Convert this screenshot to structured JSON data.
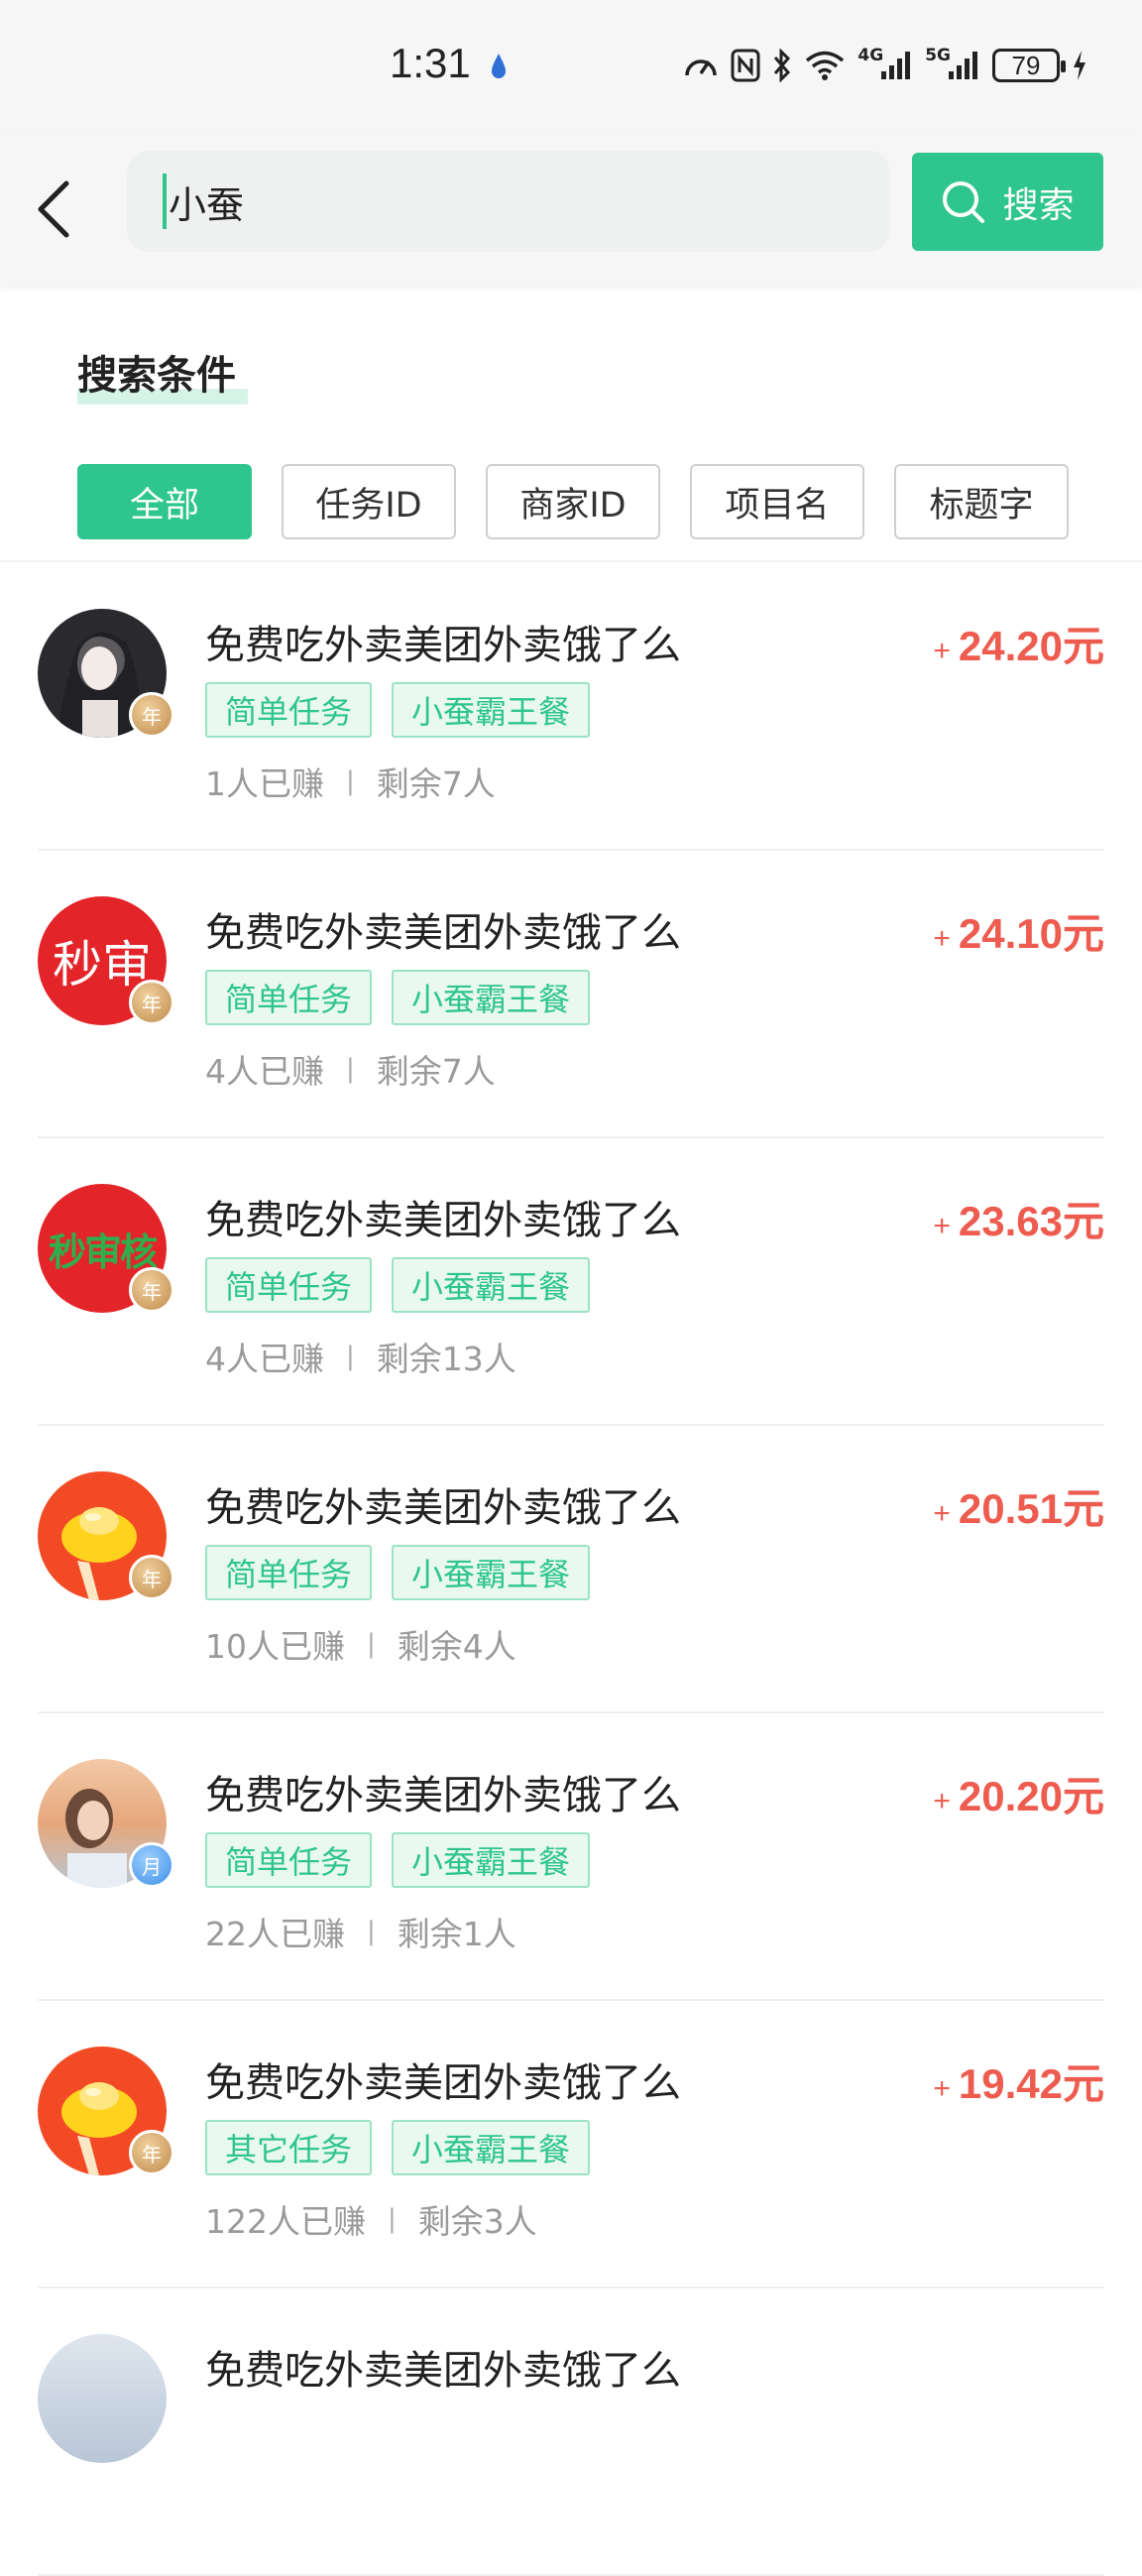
{
  "status_bar": {
    "time": "1:31",
    "signal_4g": "4G",
    "signal_5g": "5G",
    "battery": "79",
    "icons": [
      "speed-icon",
      "nfc-icon",
      "bluetooth-icon",
      "wifi-icon",
      "signal-icon",
      "signal-icon",
      "battery-icon",
      "charging-icon"
    ]
  },
  "search": {
    "value": "小蚕",
    "button_label": "搜索"
  },
  "filters": {
    "title": "搜索条件",
    "tabs": [
      "全部",
      "任务ID",
      "商家ID",
      "项目名",
      "标题字"
    ],
    "active_index": 0
  },
  "tasks": [
    {
      "title": "免费吃外卖美团外卖饿了么",
      "price": "24.20元",
      "tags": [
        "简单任务",
        "小蚕霸王餐"
      ],
      "earned": "1人已赚",
      "remaining": "剩余7人",
      "avatar_text": "",
      "level": "年"
    },
    {
      "title": "免费吃外卖美团外卖饿了么",
      "price": "24.10元",
      "tags": [
        "简单任务",
        "小蚕霸王餐"
      ],
      "earned": "4人已赚",
      "remaining": "剩余7人",
      "avatar_text": "秒审",
      "level": "年"
    },
    {
      "title": "免费吃外卖美团外卖饿了么",
      "price": "23.63元",
      "tags": [
        "简单任务",
        "小蚕霸王餐"
      ],
      "earned": "4人已赚",
      "remaining": "剩余13人",
      "avatar_text": "秒审核",
      "level": "年"
    },
    {
      "title": "免费吃外卖美团外卖饿了么",
      "price": "20.51元",
      "tags": [
        "简单任务",
        "小蚕霸王餐"
      ],
      "earned": "10人已赚",
      "remaining": "剩余4人",
      "avatar_text": "",
      "level": "年"
    },
    {
      "title": "免费吃外卖美团外卖饿了么",
      "price": "20.20元",
      "tags": [
        "简单任务",
        "小蚕霸王餐"
      ],
      "earned": "22人已赚",
      "remaining": "剩余1人",
      "avatar_text": "",
      "level": "月"
    },
    {
      "title": "免费吃外卖美团外卖饿了么",
      "price": "19.42元",
      "tags": [
        "其它任务",
        "小蚕霸王餐"
      ],
      "earned": "122人已赚",
      "remaining": "剩余3人",
      "avatar_text": "",
      "level": "年"
    },
    {
      "title": "免费吃外卖美团外卖饿了么",
      "price": "",
      "tags": [],
      "earned": "",
      "remaining": "",
      "avatar_text": "",
      "level": ""
    }
  ],
  "colors": {
    "accent": "#2ec58e",
    "price": "#ee5b4f",
    "tag_bg": "#e9f8f1"
  }
}
